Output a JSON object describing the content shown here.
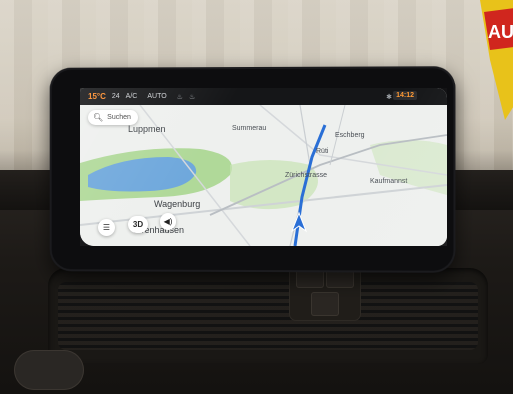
{
  "status_bar": {
    "temperature": "15°C",
    "fan_level": "24",
    "ac_label": "A/C",
    "auto_label": "AUTO",
    "time": "14:12"
  },
  "map": {
    "search_placeholder": "Suchen",
    "view_mode_label": "3D",
    "places": [
      {
        "name": "Luppmen",
        "size": "big"
      },
      {
        "name": "Summerau",
        "size": "small"
      },
      {
        "name": "Eschberg",
        "size": "small"
      },
      {
        "name": "Rüti",
        "size": "small"
      },
      {
        "name": "Zürichstrasse",
        "size": "small"
      },
      {
        "name": "Wagenburg",
        "size": "big"
      },
      {
        "name": "Gfrenhausen",
        "size": "big"
      },
      {
        "name": "Kaufmannst",
        "size": "small"
      }
    ]
  },
  "colors": {
    "temperature": "#ff8c2a",
    "time": "#ff9933",
    "water": "#6fa8dc",
    "park": "#a8d68f",
    "route": "#2a6fd6"
  },
  "icons": [
    "search-icon",
    "menu-icon",
    "volume-icon",
    "bluetooth-icon",
    "camera-icon",
    "seat-heat-icon",
    "navigation-arrow-icon",
    "auto-sign-logo"
  ]
}
